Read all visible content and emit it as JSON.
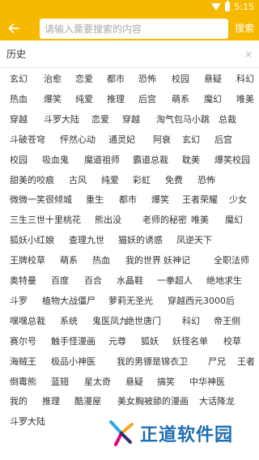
{
  "status": {
    "time": "5:15"
  },
  "search": {
    "placeholder": "请输入需要搜索的内容",
    "button": "搜索"
  },
  "history": {
    "title": "历史",
    "clear": "×"
  },
  "rows": [
    [
      "玄幻",
      "治愈",
      "恋爱",
      "都市",
      "恐怖",
      "校园",
      "悬疑",
      "科幻"
    ],
    [
      "热血",
      "爆笑",
      "纯爱",
      "推理",
      "后宫",
      "萌系",
      "魔幻",
      "唯美"
    ],
    [
      "穿越",
      "斗罗大陆",
      "恋爱",
      "穿越",
      "淘气包马小跳",
      "总裁"
    ],
    [
      "斗破苍穹",
      "怦然心动",
      "通灵妃",
      "阿衰",
      "玄幻",
      "后宫"
    ],
    [
      "校园",
      "吸血鬼",
      "魔道祖师",
      "霸道总裁",
      "耽美",
      "爆笑校园"
    ],
    [
      "甜美的咬痕",
      "古风",
      "纯爱",
      "彩虹",
      "免费",
      "恐怖"
    ],
    [
      "微微一笑很倾城",
      "重生",
      "都市",
      "爆笑",
      "王者荣耀",
      "少女"
    ],
    [
      "三生三世十里桃花",
      "熊出没",
      "老师的秘密",
      "唯美",
      "魔幻"
    ],
    [
      "狐妖小红娘",
      "查理九世",
      "猫妖的诱惑",
      "凤逆天下"
    ],
    [
      "王牌校草",
      "萌系",
      "热血",
      "我的世界",
      "妖神记",
      "全职法师"
    ],
    [
      "奥特曼",
      "百度",
      "百合",
      "水晶鞋",
      "一拳超人",
      "绝地求生"
    ],
    [
      "斗罗",
      "植物大战僵尸",
      "萝莉无圣光",
      "穿越西元3000后"
    ],
    [
      "嘿嘿总裁",
      "系统",
      "鬼医凤九",
      "绝世唐门",
      "科幻",
      "帝王侧"
    ],
    [
      "赛尔号",
      "触手怪漫画",
      "元尊",
      "狐妖",
      "妖怪名单",
      "校草"
    ],
    [
      "海贼王",
      "极品小神医",
      "我的男镖是锦衣卫",
      "尸兄",
      "王者"
    ],
    [
      "倒霉熊",
      "蓝翅",
      "星太奇",
      "悬疑",
      "搞笑",
      "中华神医"
    ],
    [
      "我的",
      "推理",
      "酷漫屋",
      "美女胸被舔的漫画",
      "大话降龙"
    ],
    [
      "斗罗大陆"
    ]
  ],
  "watermark": {
    "text": "正道软件园"
  }
}
